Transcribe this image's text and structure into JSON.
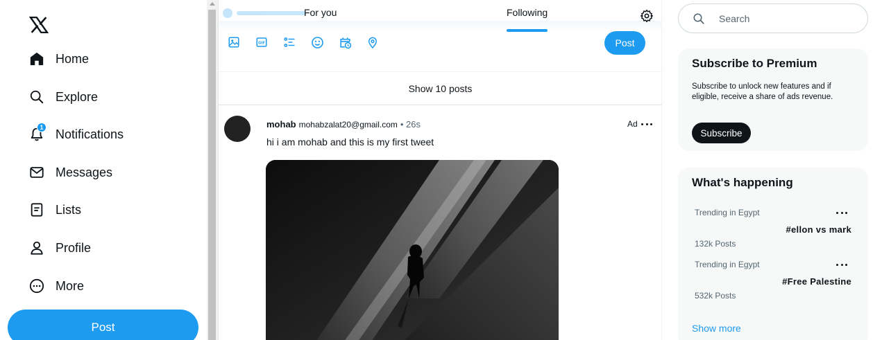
{
  "nav": {
    "items": [
      {
        "label": "Home",
        "icon": "home-icon"
      },
      {
        "label": "Explore",
        "icon": "search-icon"
      },
      {
        "label": "Notifications",
        "icon": "bell-icon",
        "badge": "1"
      },
      {
        "label": "Messages",
        "icon": "envelope-icon"
      },
      {
        "label": "Lists",
        "icon": "list-icon"
      },
      {
        "label": "Profile",
        "icon": "person-icon"
      },
      {
        "label": "More",
        "icon": "more-circle-icon"
      }
    ],
    "post_label": "Post"
  },
  "feed": {
    "tabs": [
      {
        "label": "For you",
        "active": false
      },
      {
        "label": "Following",
        "active": true
      }
    ],
    "compose": {
      "tools": [
        "image-icon",
        "gif-icon",
        "poll-icon",
        "emoji-icon",
        "schedule-icon",
        "location-icon"
      ],
      "post_label": "Post"
    },
    "show_posts": "Show 10 posts",
    "tweet": {
      "name": "mohab",
      "email": "mohabzalat20@gmail.com",
      "time": "• 26s",
      "ad_label": "Ad",
      "text": "hi i am mohab and this is my first tweet"
    }
  },
  "search": {
    "placeholder": "Search"
  },
  "premium": {
    "title": "Subscribe to Premium",
    "description": "Subscribe to unlock new features and if eligible, receive a share of ads revenue.",
    "button": "Subscribe"
  },
  "trends": {
    "title": "What's happening",
    "items": [
      {
        "meta": "Trending in Egypt",
        "name": "#ellon vs mark",
        "count": "132k Posts"
      },
      {
        "meta": "Trending in Egypt",
        "name": "#Free Palestine",
        "count": "532k Posts"
      }
    ],
    "show_more": "Show more"
  },
  "colors": {
    "accent": "#1d9bf0",
    "text": "#0f1419",
    "muted": "#536471",
    "card_bg": "#f7f9f9"
  }
}
